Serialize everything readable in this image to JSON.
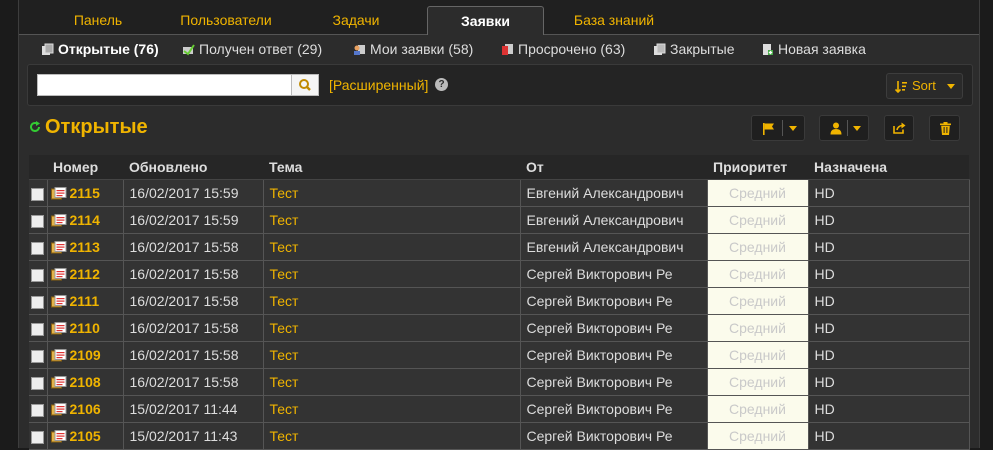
{
  "tabs": [
    {
      "label": "Панель",
      "active": false
    },
    {
      "label": "Пользователи",
      "active": false
    },
    {
      "label": "Задачи",
      "active": false
    },
    {
      "label": "Заявки",
      "active": true
    },
    {
      "label": "База знаний",
      "active": false
    }
  ],
  "subnav": [
    {
      "label": "Открытые (76)",
      "icon": "open-tickets-icon"
    },
    {
      "label": "Получен ответ (29)",
      "icon": "answered-icon"
    },
    {
      "label": "Мои заявки (58)",
      "icon": "my-tickets-icon"
    },
    {
      "label": "Просрочено (63)",
      "icon": "overdue-icon"
    },
    {
      "label": "Закрытые",
      "icon": "closed-icon"
    },
    {
      "label": "Новая заявка",
      "icon": "new-ticket-icon"
    }
  ],
  "search": {
    "value": "",
    "button_icon": "search-icon",
    "advanced_label": "[Расширенный]",
    "help": "?"
  },
  "sort": {
    "label": "Sort"
  },
  "page_title": "Открытые",
  "table": {
    "columns": [
      "Номер",
      "Обновлено",
      "Тема",
      "От",
      "Приоритет",
      "Назначена"
    ],
    "rows": [
      {
        "number": "2115",
        "updated": "16/02/2017 15:59",
        "subject": "Тест",
        "from": "Евгений Александрович",
        "priority": "Средний",
        "assigned": "HD"
      },
      {
        "number": "2114",
        "updated": "16/02/2017 15:59",
        "subject": "Тест",
        "from": "Евгений Александрович",
        "priority": "Средний",
        "assigned": "HD"
      },
      {
        "number": "2113",
        "updated": "16/02/2017 15:58",
        "subject": "Тест",
        "from": "Евгений Александрович",
        "priority": "Средний",
        "assigned": "HD"
      },
      {
        "number": "2112",
        "updated": "16/02/2017 15:58",
        "subject": "Тест",
        "from": "Сергей Викторович Ре",
        "priority": "Средний",
        "assigned": "HD"
      },
      {
        "number": "2111",
        "updated": "16/02/2017 15:58",
        "subject": "Тест",
        "from": "Сергей Викторович Ре",
        "priority": "Средний",
        "assigned": "HD"
      },
      {
        "number": "2110",
        "updated": "16/02/2017 15:58",
        "subject": "Тест",
        "from": "Сергей Викторович Ре",
        "priority": "Средний",
        "assigned": "HD"
      },
      {
        "number": "2109",
        "updated": "16/02/2017 15:58",
        "subject": "Тест",
        "from": "Сергей Викторович Ре",
        "priority": "Средний",
        "assigned": "HD"
      },
      {
        "number": "2108",
        "updated": "16/02/2017 15:58",
        "subject": "Тест",
        "from": "Сергей Викторович Ре",
        "priority": "Средний",
        "assigned": "HD"
      },
      {
        "number": "2106",
        "updated": "15/02/2017 11:44",
        "subject": "Тест",
        "from": "Сергей Викторович Ре",
        "priority": "Средний",
        "assigned": "HD"
      },
      {
        "number": "2105",
        "updated": "15/02/2017 11:43",
        "subject": "Тест",
        "from": "Сергей Викторович Ре",
        "priority": "Средний",
        "assigned": "HD"
      }
    ]
  },
  "colors": {
    "accent": "#f0b400",
    "bg": "#2c2c2c",
    "priority_bg": "#fbfbec"
  }
}
